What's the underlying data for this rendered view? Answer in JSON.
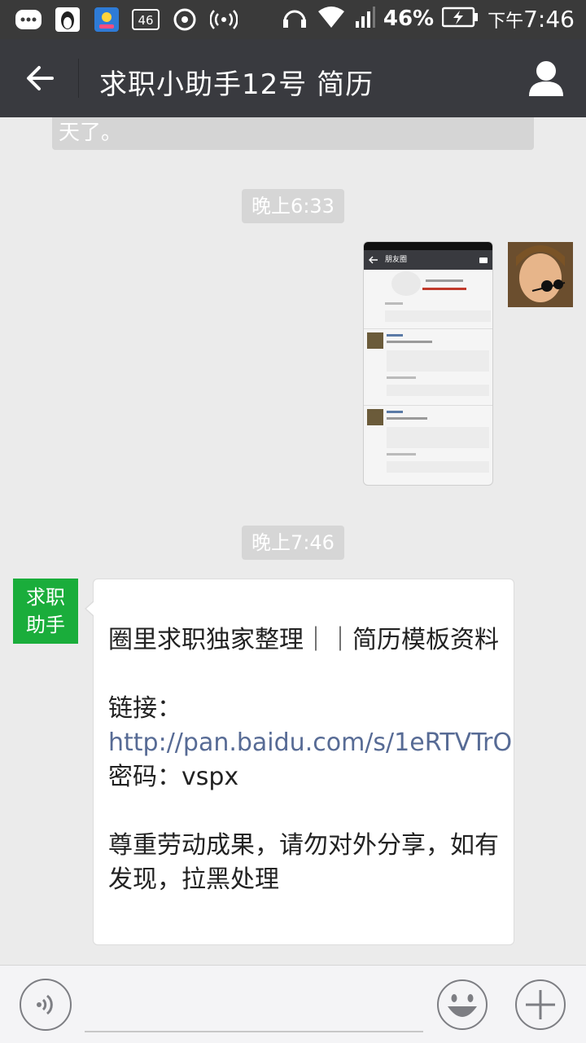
{
  "statusbar": {
    "battery_percent": "46%",
    "time_prefix": "下午",
    "time": "7:46",
    "network_badge": "46",
    "icons": [
      "message-icon",
      "penguin-icon",
      "app-icon",
      "network-46-icon",
      "netease-icon",
      "hotspot-icon",
      "headset-icon",
      "wifi-icon",
      "signal-icon",
      "battery-charging-icon"
    ]
  },
  "titlebar": {
    "title": "求职小助手12号   简历",
    "back_icon": "back-arrow-icon",
    "profile_icon": "person-icon"
  },
  "chat": {
    "previous_message_tail": "天了。",
    "timestamps": [
      "晚上6:33",
      "晚上7:46"
    ],
    "image_message": {
      "header_label": "朋友圈",
      "sender": "user"
    },
    "bot_avatar_text": [
      "求职",
      "助手"
    ],
    "message": {
      "line1": "圈里求职独家整理｜｜简历模板资料",
      "link_prefix": "链接：",
      "link_url": "http://pan.baidu.com/s/1eRTVTrO",
      "password": " 密码：vspx",
      "line3": "尊重劳动成果，请勿对外分享，如有发现，拉黑处理"
    }
  },
  "colors": {
    "titlebar": "#393a3f",
    "statusbar": "#3a3a3a",
    "background": "#ebebeb",
    "bot_green": "#1aad3b",
    "link": "#576b95"
  }
}
